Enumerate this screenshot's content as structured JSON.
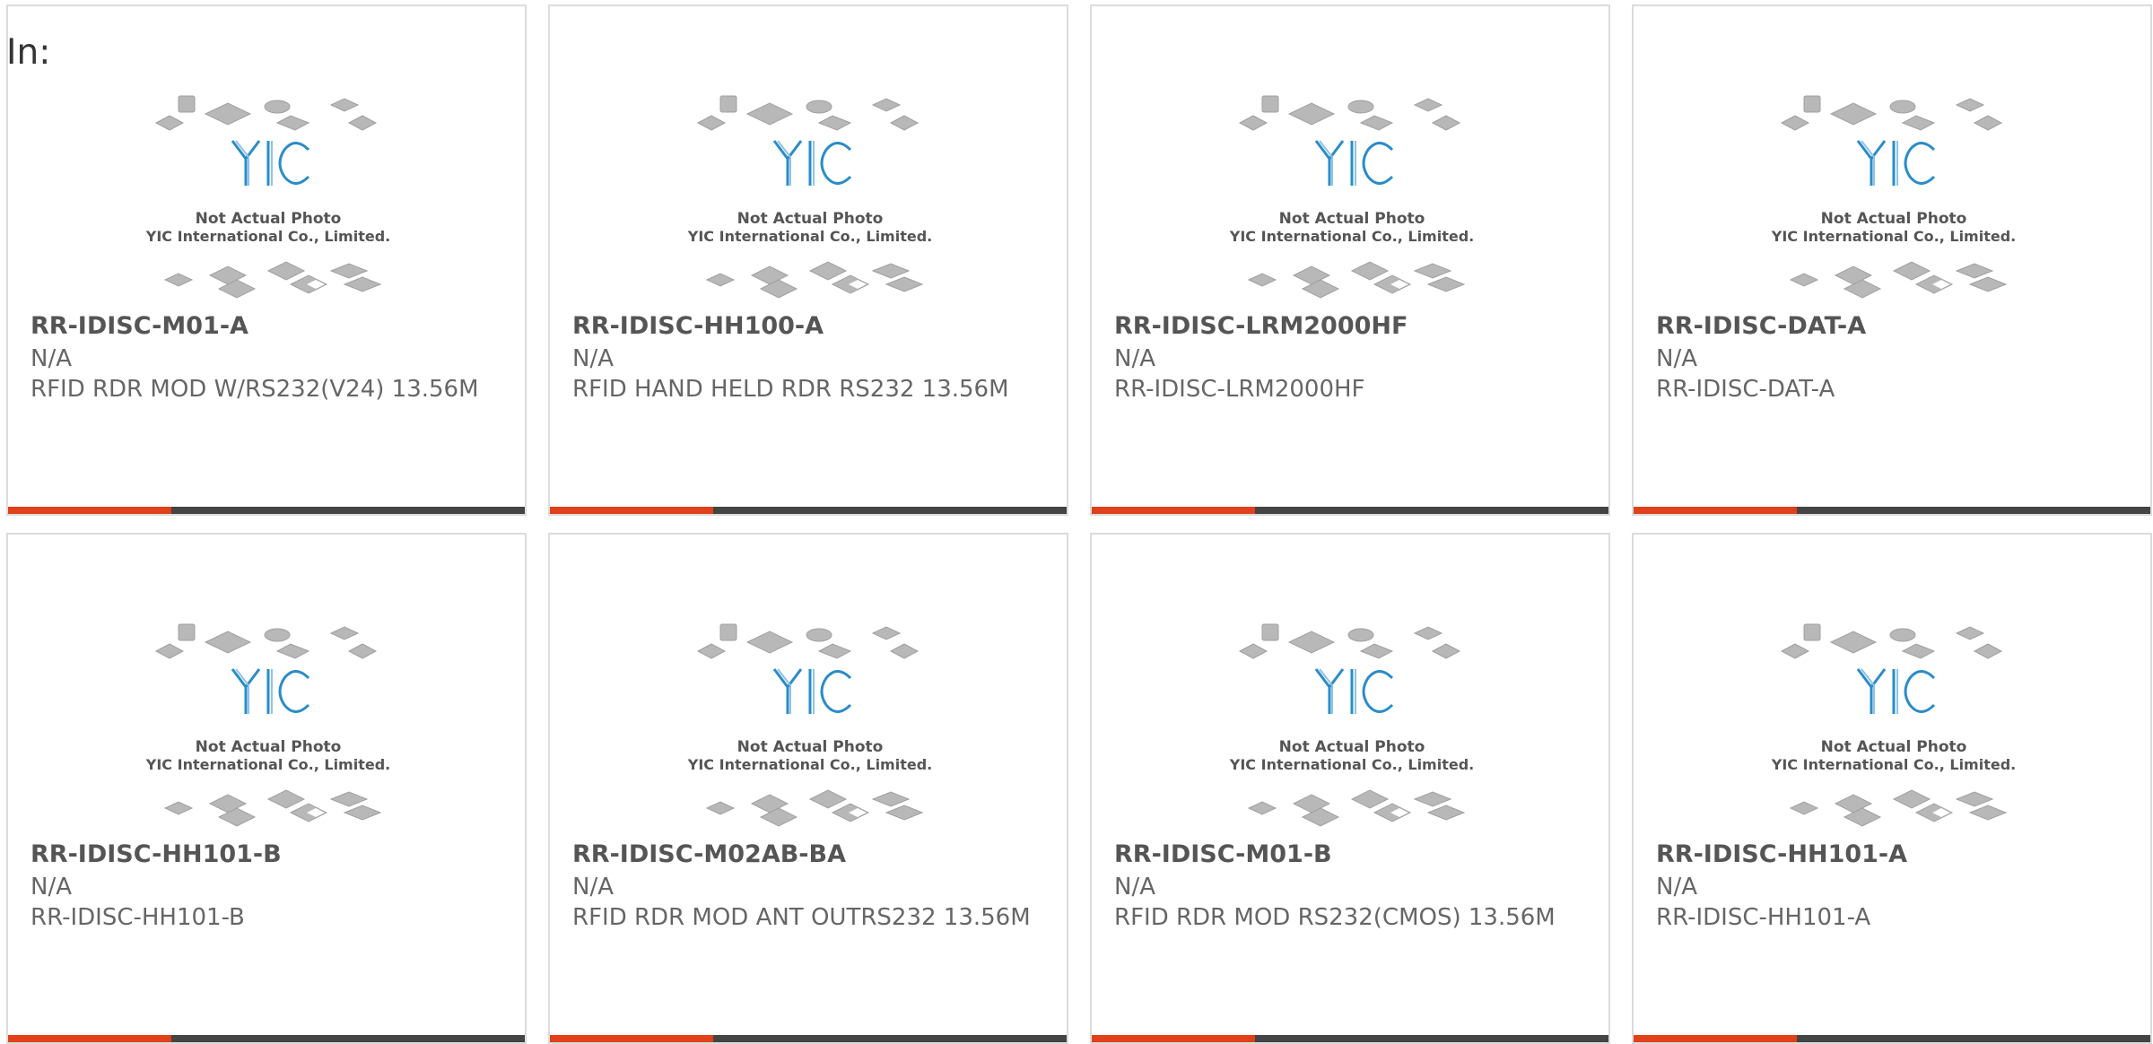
{
  "header": {
    "in_label": "In:"
  },
  "colors": {
    "accent": "#e0401a",
    "bar": "#444444",
    "logo": "#2a8cc8"
  },
  "placeholder": {
    "line1": "Not Actual Photo",
    "line2": "YIC International Co., Limited.",
    "logo_text": "YIC"
  },
  "products": [
    {
      "name": "RR-IDISC-M01-A",
      "manufacturer": "N/A",
      "description": "RFID RDR MOD W/RS232(V24) 13.56M"
    },
    {
      "name": "RR-IDISC-HH100-A",
      "manufacturer": "N/A",
      "description": "RFID HAND HELD RDR RS232 13.56M"
    },
    {
      "name": "RR-IDISC-LRM2000HF",
      "manufacturer": "N/A",
      "description": "RR-IDISC-LRM2000HF"
    },
    {
      "name": "RR-IDISC-DAT-A",
      "manufacturer": "N/A",
      "description": "RR-IDISC-DAT-A"
    },
    {
      "name": "RR-IDISC-HH101-B",
      "manufacturer": "N/A",
      "description": "RR-IDISC-HH101-B"
    },
    {
      "name": "RR-IDISC-M02AB-BA",
      "manufacturer": "N/A",
      "description": "RFID RDR MOD ANT OUTRS232 13.56M"
    },
    {
      "name": "RR-IDISC-M01-B",
      "manufacturer": "N/A",
      "description": "RFID RDR MOD RS232(CMOS) 13.56M"
    },
    {
      "name": "RR-IDISC-HH101-A",
      "manufacturer": "N/A",
      "description": "RR-IDISC-HH101-A"
    }
  ]
}
